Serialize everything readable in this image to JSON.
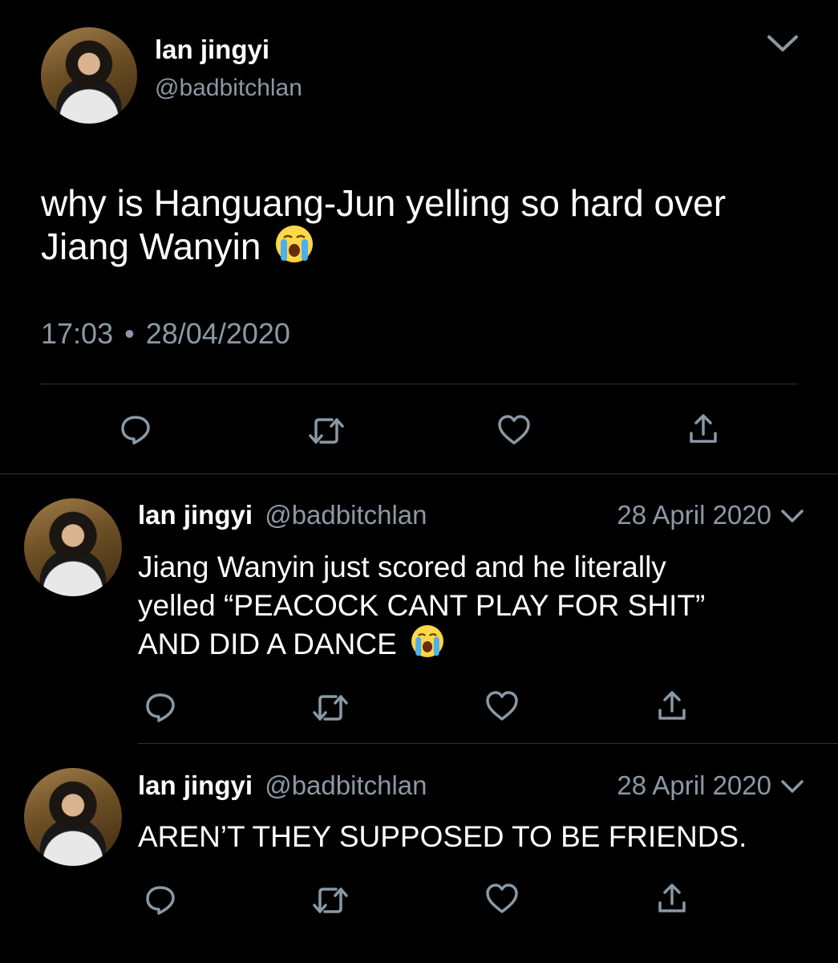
{
  "main_tweet": {
    "display_name": "lan jingyi",
    "handle": "@badbitchlan",
    "text": "why is Hanguang-Jun yelling so hard over Jiang Wanyin",
    "time": "17:03",
    "separator": "•",
    "date": "28/04/2020",
    "emoji": "loudly-crying-face"
  },
  "replies": [
    {
      "display_name": "lan jingyi",
      "handle": "@badbitchlan",
      "date": "28 April 2020",
      "line1": "Jiang Wanyin just scored and he literally",
      "line2": "yelled “PEACOCK CANT PLAY FOR SHIT”",
      "line3": "AND DID A DANCE",
      "emoji": "loudly-crying-face"
    },
    {
      "display_name": "lan jingyi",
      "handle": "@badbitchlan",
      "date": "28 April 2020",
      "line1": "AREN’T THEY SUPPOSED TO BE FRIENDS."
    }
  ],
  "icons": {
    "reply": "reply-icon",
    "retweet": "retweet-icon",
    "like": "like-icon",
    "share": "share-icon",
    "more": "chevron-down-icon"
  },
  "colors": {
    "background": "#000000",
    "text": "#ffffff",
    "muted": "#8b98a5",
    "divider": "#2f3336"
  }
}
